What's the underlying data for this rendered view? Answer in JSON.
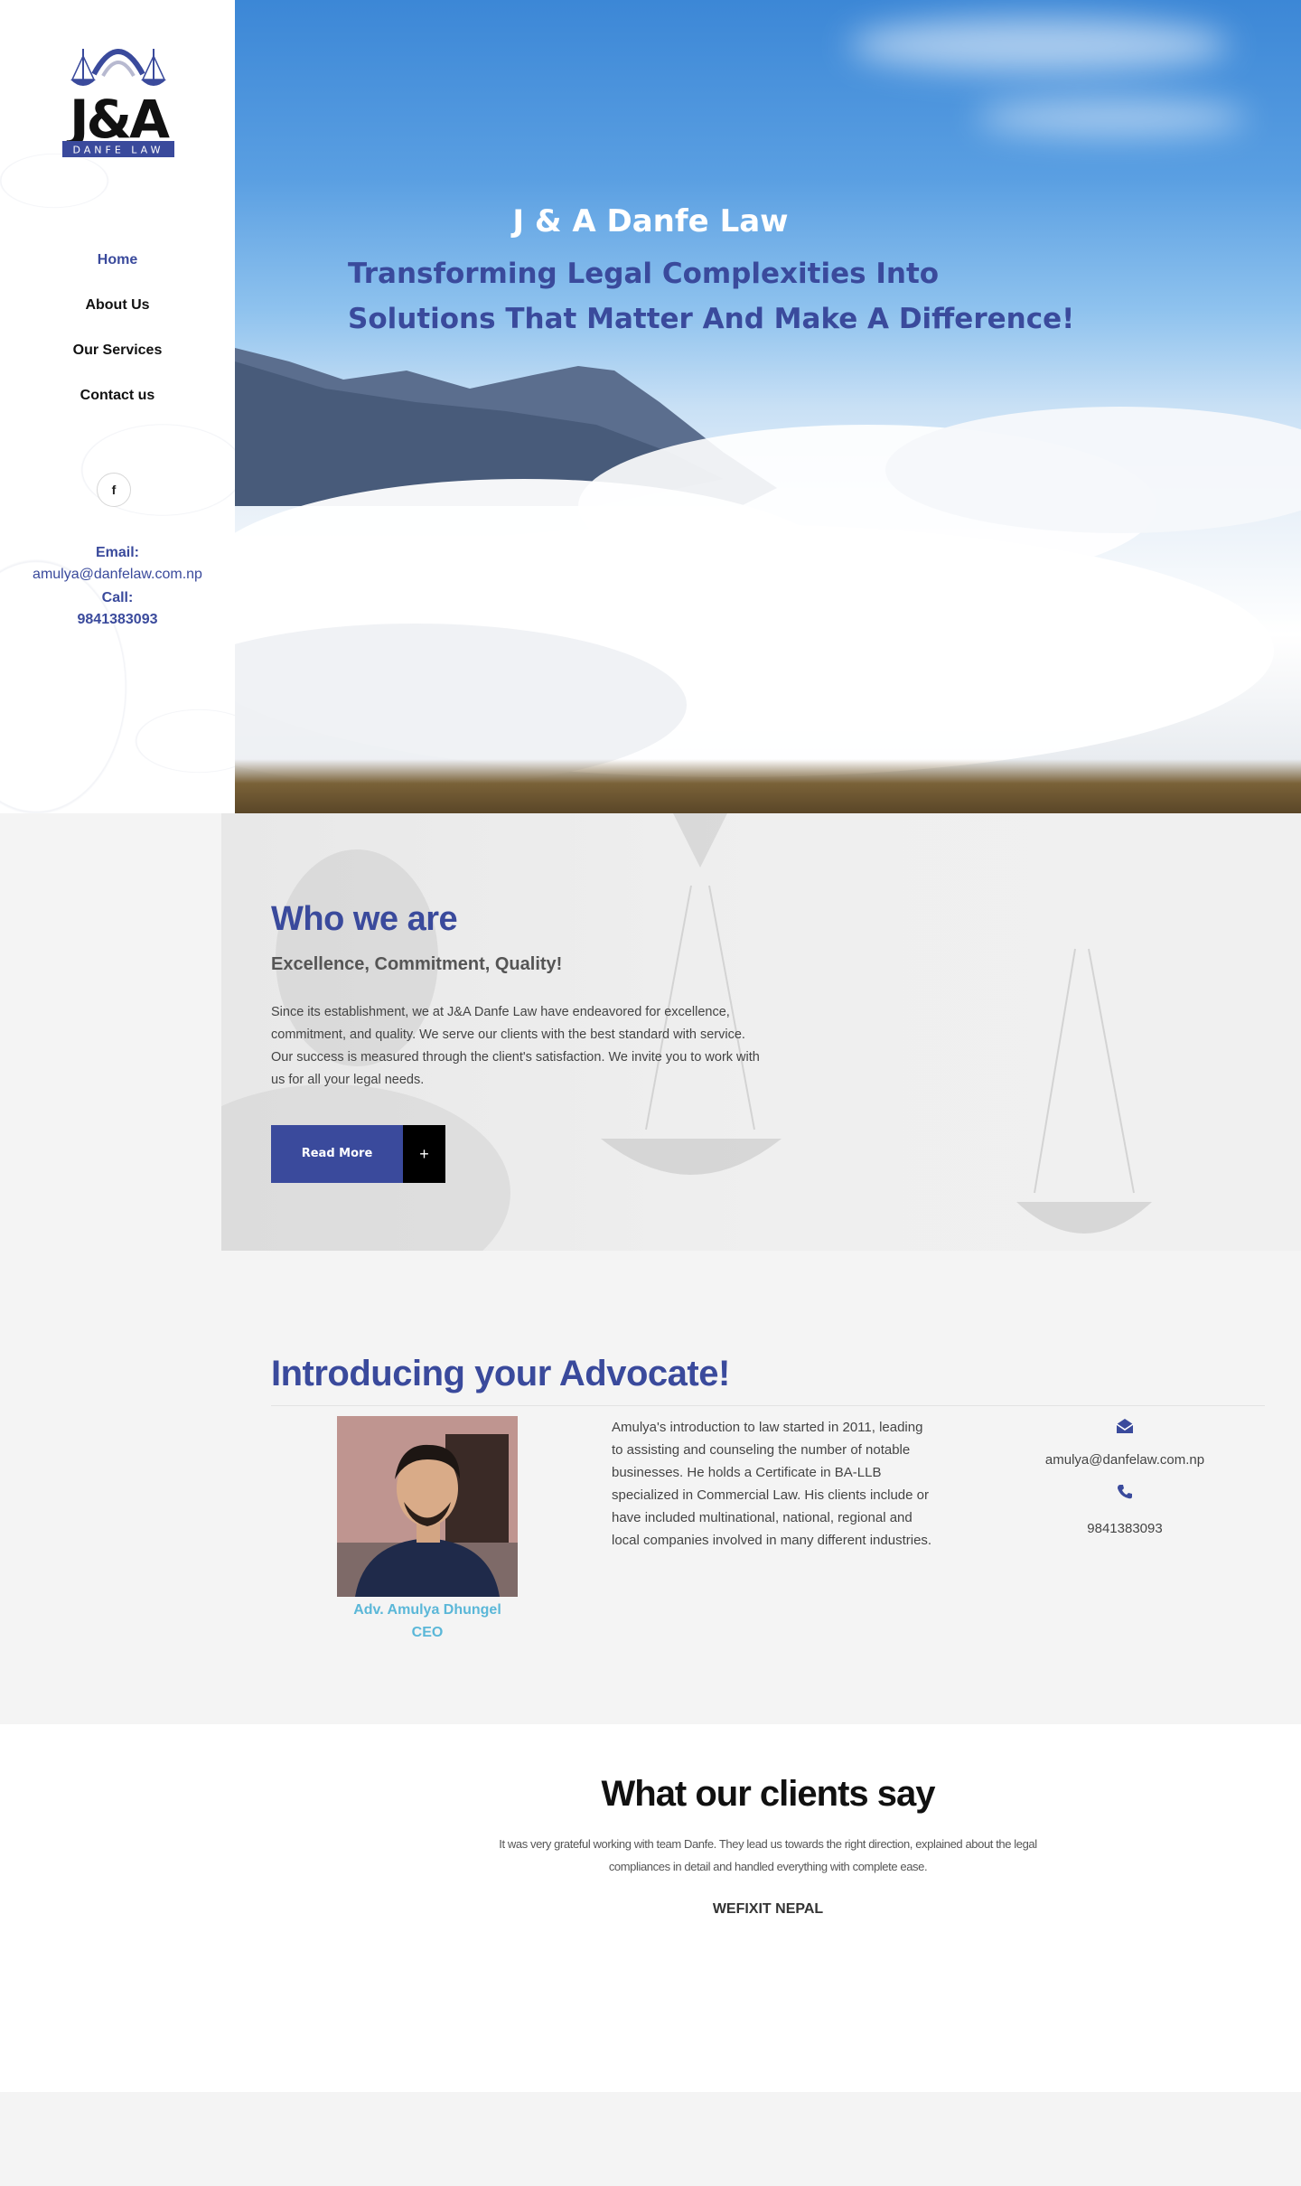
{
  "brand": {
    "logo_text": "J&A",
    "logo_sub": "DANFE LAW",
    "primary_color": "#3a4a9c",
    "accent_color": "#5ab7d8"
  },
  "nav": {
    "items": [
      {
        "label": "Home",
        "active": true
      },
      {
        "label": "About Us",
        "active": false
      },
      {
        "label": "Our Services",
        "active": false
      },
      {
        "label": "Contact us",
        "active": false
      }
    ]
  },
  "social": {
    "facebook_icon": "f"
  },
  "sidebar_contact": {
    "email_label": "Email:",
    "email": "amulya@danfelaw.com.np",
    "call_label": "Call:",
    "phone": "9841383093"
  },
  "hero": {
    "title": "J & A Danfe Law",
    "subtitle_line1": "Transforming Legal Complexities Into",
    "subtitle_line2": "Solutions That Matter And Make A Difference!"
  },
  "who": {
    "heading": "Who we are",
    "subheading": "Excellence, Commitment, Quality!",
    "body": "Since its establishment, we at J&A Danfe Law have endeavored for excellence, commitment, and quality. We serve our clients with the best standard with service. Our success is measured through the client's satisfaction. We invite you to work with us for all your legal needs.",
    "button_label": "Read More",
    "button_icon": "+"
  },
  "advocate": {
    "heading": "Introducing your Advocate!",
    "name": "Adv. Amulya Dhungel",
    "role": "CEO",
    "bio": "Amulya's introduction to law started in 2011, leading to assisting and counseling the number of notable businesses. He holds a Certificate in BA-LLB specialized in Commercial Law. His clients include or have included multinational, national, regional and local companies involved in many different industries.",
    "email": "amulya@danfelaw.com.np",
    "phone": "9841383093"
  },
  "testimonials": {
    "heading": "What our clients say",
    "quote": "It was very grateful working with team Danfe. They lead us towards the right direction, explained about the legal compliances in detail and handled everything with complete ease.",
    "client": "WEFIXIT NEPAL"
  }
}
